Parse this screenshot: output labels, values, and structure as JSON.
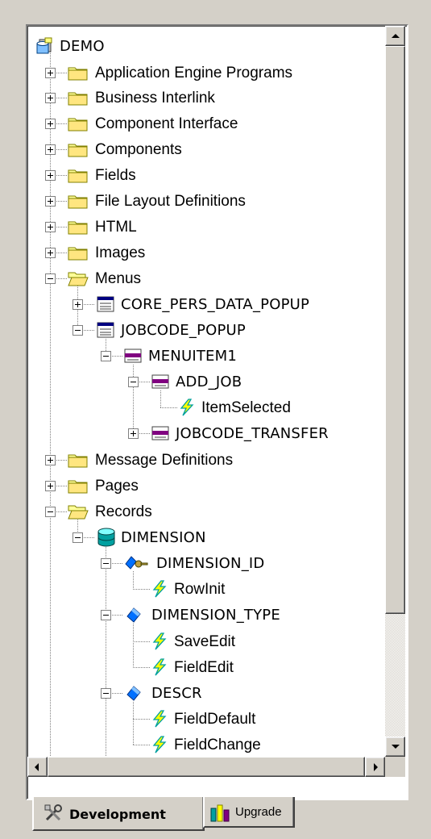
{
  "tree": {
    "root": "DEMO",
    "folders_top": [
      "Application Engine Programs",
      "Business Interlink",
      "Component Interface",
      "Components",
      "Fields",
      "File Layout Definitions",
      "HTML",
      "Images"
    ],
    "menus": {
      "label": "Menus",
      "core_pers": "CORE_PERS_DATA_POPUP",
      "jobcode_popup": "JOBCODE_POPUP",
      "menuitem1": "MENUITEM1",
      "add_job": "ADD_JOB",
      "item_selected": "ItemSelected",
      "jobcode_transfer": "JOBCODE_TRANSFER"
    },
    "message_definitions": "Message Definitions",
    "pages": "Pages",
    "records": {
      "label": "Records",
      "dimension": "DIMENSION",
      "dimension_id": "DIMENSION_ID",
      "rowinit": "RowInit",
      "dimension_type": "DIMENSION_TYPE",
      "saveedit": "SaveEdit",
      "fieldedit": "FieldEdit",
      "descr": "DESCR",
      "fielddefault": "FieldDefault",
      "fieldchange": "FieldChange"
    }
  },
  "tabs": {
    "development": "Development",
    "upgrade": "Upgrade"
  },
  "icons": {
    "root": "database-project-icon",
    "folder": "folder-icon",
    "folder_open": "folder-open-icon",
    "menu": "menu-definition-icon",
    "menuitem": "menu-item-icon",
    "peoplecode": "peoplecode-lightning-icon",
    "record": "record-cylinder-icon",
    "key_field": "key-field-icon",
    "field": "field-diamond-icon",
    "tools": "tools-icon",
    "upgrade": "upgrade-icon"
  },
  "colors": {
    "window_bg": "#d4d0c8",
    "folder_yellow": "#ffff99",
    "folder_outline": "#808000",
    "peoplecode_yellow": "#ffff00",
    "menu_purple": "#800080",
    "record_teal": "#00a0a0",
    "field_blue": "#0070ff"
  }
}
